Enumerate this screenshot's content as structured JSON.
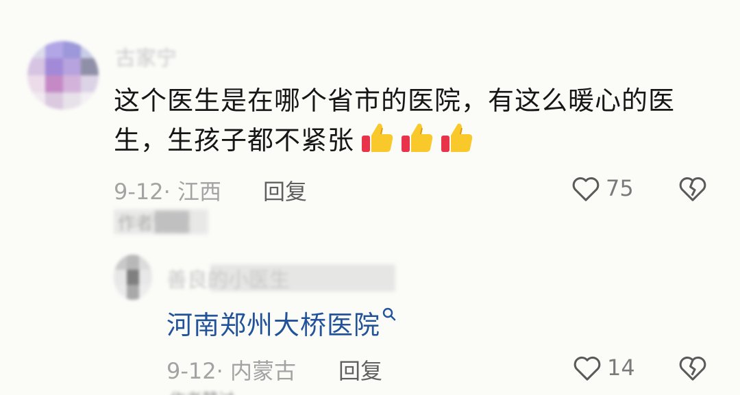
{
  "comment": {
    "author_name": "古家宁",
    "text": "这个医生是在哪个省市的医院，有这么暖心的医生，生孩子都不紧张",
    "date_location": "9-12· 江西",
    "reply_label": "回复",
    "like_count": "75",
    "author_tag": "作者赞过"
  },
  "reply": {
    "author_name": "善良的小医生",
    "text": "河南郑州大桥医院",
    "search_glyph": "ᵠ",
    "date_location": "9-12· 内蒙古",
    "reply_label": "回复",
    "like_count": "14",
    "author_tag": "作者赞过"
  },
  "colors": {
    "link_blue": "#22539a",
    "meta_gray": "#a3a3a3",
    "icon_gray": "#5a5a5a",
    "background": "#fbfbf8"
  },
  "icons": [
    "heart-outline-icon",
    "broken-heart-icon",
    "thumbs-up-emoji",
    "search-icon"
  ]
}
